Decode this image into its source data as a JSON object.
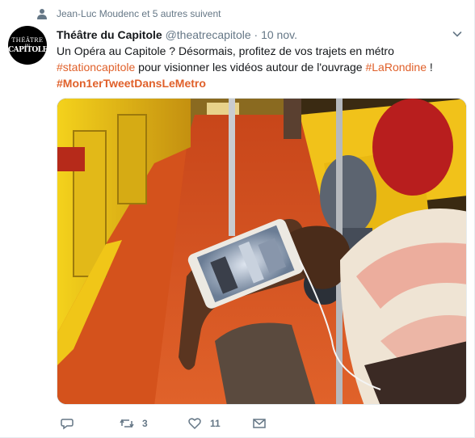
{
  "context": {
    "text": "Jean-Luc Moudenc et 5 autres suivent",
    "icon": "person-icon"
  },
  "avatar": {
    "logo_line1": "THÉÂTRE",
    "logo_line2": "DU",
    "logo_line3": "CAPITOLE"
  },
  "tweet": {
    "name": "Théâtre du Capitole",
    "handle": "@theatrecapitole",
    "separator": "·",
    "time": "10 nov.",
    "text_part1": "Un Opéra au Capitole ? Désormais, profitez de vos trajets en métro",
    "hashtag1": "#stationcapitole",
    "text_part2": " pour visionner les vidéos autour de l'ouvrage ",
    "hashtag2": "#LaRondine",
    "text_part3": " !",
    "hashtag3": "#Mon1erTweetDansLeMetro"
  },
  "actions": {
    "reply": {
      "icon": "reply-icon",
      "count": ""
    },
    "retweet": {
      "icon": "retweet-icon",
      "count": "3"
    },
    "like": {
      "icon": "heart-icon",
      "count": "11"
    },
    "dm": {
      "icon": "envelope-icon",
      "count": ""
    }
  },
  "colors": {
    "hashtag": "#e0602a",
    "secondary_text": "#657786",
    "metro_yellow": "#f3c300",
    "floor_orange": "#d4521c"
  }
}
